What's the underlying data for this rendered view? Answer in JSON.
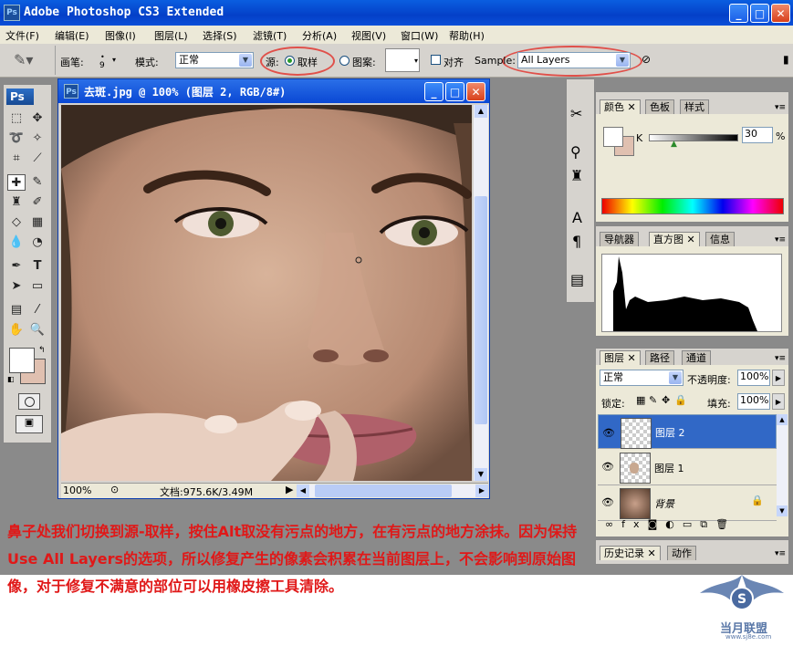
{
  "window": {
    "title": "Adobe Photoshop CS3 Extended",
    "app_badge": "Ps"
  },
  "menu": [
    "文件(F)",
    "编辑(E)",
    "图像(I)",
    "图层(L)",
    "选择(S)",
    "滤镜(T)",
    "分析(A)",
    "视图(V)",
    "窗口(W)",
    "帮助(H)"
  ],
  "options": {
    "brush_label": "画笔:",
    "brush_size": "9",
    "mode_label": "模式:",
    "mode_value": "正常",
    "source_label": "源:",
    "sampled_label": "取样",
    "pattern_label": "图案:",
    "aligned_label": "对齐",
    "sample_label": "Sample:",
    "sample_value": "All Layers"
  },
  "toolbox": {
    "badge": "Ps"
  },
  "document": {
    "title": "去斑.jpg @ 100% (图层 2, RGB/8#)",
    "zoom": "100%",
    "doc_size": "文档:975.6K/3.49M"
  },
  "color_panel": {
    "tabs": [
      "颜色",
      "色板",
      "样式"
    ],
    "channel_label": "K",
    "value": "30",
    "unit": "%",
    "foreground": "#ffffff",
    "background": "#e0c0b0"
  },
  "navigator_panel": {
    "tabs": [
      "导航器",
      "直方图",
      "信息"
    ]
  },
  "layers_panel": {
    "tabs": [
      "图层",
      "路径",
      "通道"
    ],
    "blend_mode": "正常",
    "opacity_label": "不透明度:",
    "opacity_value": "100%",
    "lock_label": "锁定:",
    "fill_label": "填充:",
    "fill_value": "100%",
    "layers": [
      {
        "name": "图层 2",
        "selected": true
      },
      {
        "name": "图层 1",
        "selected": false
      },
      {
        "name": "背景",
        "selected": false
      }
    ]
  },
  "history_panel": {
    "tabs": [
      "历史记录",
      "动作"
    ]
  },
  "caption": "鼻子处我们切换到源-取样，按住Alt取没有污点的地方，在有污点的地方涂抹。因为保持Use All Layers的选项，所以修复产生的像素会积累在当前图层上，不会影响到原始图像，对于修复不满意的部位可以用橡皮擦工具清除。",
  "watermark": {
    "text": "当月联盟",
    "url_text": "www.sj8e.com"
  },
  "colors": {
    "accent_blue": "#0a48d4",
    "highlight_red": "#e0504a",
    "caption_red": "#e01818"
  }
}
